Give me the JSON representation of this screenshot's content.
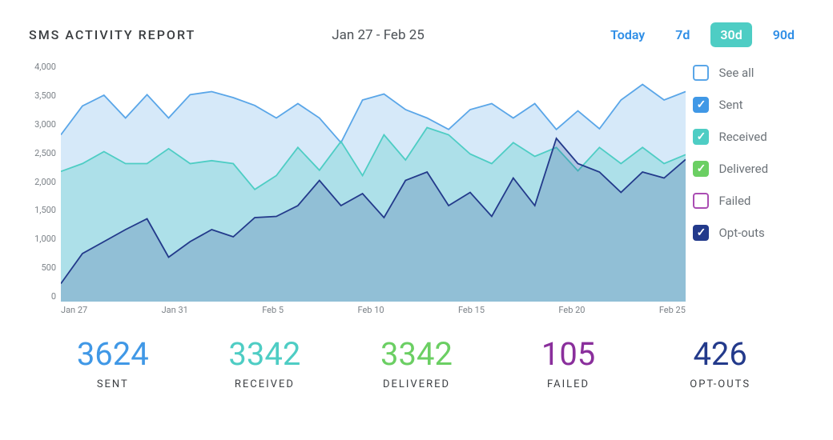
{
  "header": {
    "title": "SMS ACTIVITY REPORT",
    "range_label": "Jan 27 - Feb 25",
    "picker": [
      {
        "label": "Today",
        "active": false
      },
      {
        "label": "7d",
        "active": false
      },
      {
        "label": "30d",
        "active": true
      },
      {
        "label": "90d",
        "active": false
      }
    ]
  },
  "chart_data": {
    "type": "area",
    "title": "SMS Activity Report",
    "xlabel": "",
    "ylabel": "",
    "ylim": [
      0,
      4000
    ],
    "y_ticks": [
      "4,000",
      "3,500",
      "3,000",
      "2,500",
      "2,000",
      "1,500",
      "1,000",
      "500",
      "0"
    ],
    "x_ticks": [
      "Jan 27",
      "Jan 31",
      "Feb 5",
      "Feb 10",
      "Feb 15",
      "Feb 20",
      "Feb 25"
    ],
    "x": [
      "Jan 27",
      "Jan 28",
      "Jan 29",
      "Jan 30",
      "Jan 31",
      "Feb 1",
      "Feb 2",
      "Feb 3",
      "Feb 4",
      "Feb 5",
      "Feb 6",
      "Feb 7",
      "Feb 8",
      "Feb 9",
      "Feb 10",
      "Feb 11",
      "Feb 12",
      "Feb 13",
      "Feb 14",
      "Feb 15",
      "Feb 16",
      "Feb 17",
      "Feb 18",
      "Feb 19",
      "Feb 20",
      "Feb 21",
      "Feb 22",
      "Feb 23",
      "Feb 24",
      "Feb 25"
    ],
    "series": [
      {
        "name": "Sent",
        "color": "#5aa6e8",
        "fill": "rgba(90,166,232,0.25)",
        "values": [
          2780,
          3260,
          3440,
          3060,
          3450,
          3060,
          3450,
          3500,
          3400,
          3270,
          3060,
          3300,
          3060,
          2650,
          3360,
          3460,
          3200,
          3060,
          2870,
          3200,
          3300,
          3060,
          3300,
          2870,
          3180,
          2880,
          3360,
          3620,
          3360,
          3500
        ]
      },
      {
        "name": "Received",
        "color": "#4ecdc4",
        "fill": "rgba(78,205,196,0.30)",
        "values": [
          2170,
          2300,
          2500,
          2300,
          2300,
          2550,
          2300,
          2350,
          2300,
          1870,
          2100,
          2570,
          2190,
          2670,
          2100,
          2780,
          2360,
          2900,
          2780,
          2460,
          2300,
          2650,
          2420,
          2570,
          2180,
          2570,
          2300,
          2570,
          2300,
          2450
        ]
      },
      {
        "name": "Opt-outs",
        "color": "#233a8b",
        "fill": "rgba(35,58,139,0.20)",
        "values": [
          300,
          800,
          1000,
          1200,
          1380,
          740,
          1000,
          1200,
          1080,
          1400,
          1420,
          1600,
          2020,
          1600,
          1800,
          1400,
          2020,
          2160,
          1600,
          1820,
          1420,
          2060,
          1600,
          2720,
          2300,
          2160,
          1820,
          2160,
          2060,
          2370
        ]
      }
    ],
    "legend": [
      {
        "name": "See all",
        "color_border": "#5aa6e8",
        "color_fill": "#ffffff",
        "checked": false
      },
      {
        "name": "Sent",
        "color_border": "#4098e6",
        "color_fill": "#4098e6",
        "checked": true
      },
      {
        "name": "Received",
        "color_border": "#4ecdc4",
        "color_fill": "#4ecdc4",
        "checked": true
      },
      {
        "name": "Delivered",
        "color_border": "#6bcf63",
        "color_fill": "#6bcf63",
        "checked": true
      },
      {
        "name": "Failed",
        "color_border": "#aa4db3",
        "color_fill": "#ffffff",
        "checked": false
      },
      {
        "name": "Opt-outs",
        "color_border": "#233a8b",
        "color_fill": "#233a8b",
        "checked": true
      }
    ]
  },
  "stats": [
    {
      "label": "SENT",
      "value": "3624",
      "color": "#4098e6"
    },
    {
      "label": "RECEIVED",
      "value": "3342",
      "color": "#4ecdc4"
    },
    {
      "label": "DELIVERED",
      "value": "3342",
      "color": "#6bcf63"
    },
    {
      "label": "FAILED",
      "value": "105",
      "color": "#8a2f9c"
    },
    {
      "label": "OPT-OUTS",
      "value": "426",
      "color": "#233a8b"
    }
  ]
}
